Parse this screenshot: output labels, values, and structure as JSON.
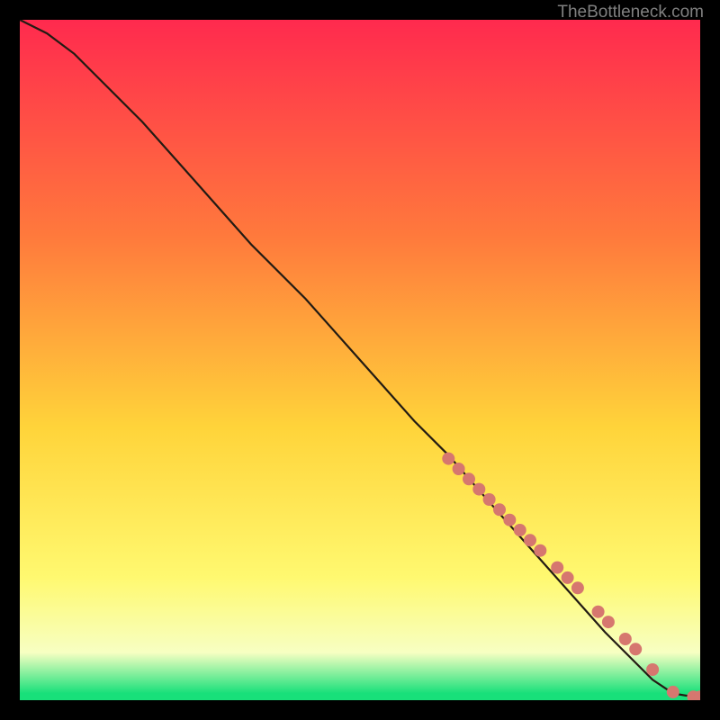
{
  "attribution": "TheBottleneck.com",
  "accent_colors": {
    "top": "#ff2a4e",
    "mid1": "#ff7a3c",
    "mid2": "#ffd43a",
    "mid3": "#fff970",
    "mid4": "#f7ffc2",
    "bottom": "#18e07a",
    "curve": "#221b13",
    "marker": "#d6776f"
  },
  "chart_data": {
    "type": "line",
    "title": "",
    "xlabel": "",
    "ylabel": "",
    "xlim": [
      0,
      100
    ],
    "ylim": [
      0,
      100
    ],
    "curve": {
      "x": [
        0,
        4,
        8,
        12,
        18,
        26,
        34,
        42,
        50,
        58,
        63,
        70,
        78,
        86,
        93,
        96,
        99,
        100
      ],
      "y": [
        100,
        98,
        95,
        91,
        85,
        76,
        67,
        59,
        50,
        41,
        36,
        28,
        19,
        10,
        3,
        1,
        0.5,
        0.5
      ]
    },
    "markers": {
      "x": [
        63,
        64.5,
        66,
        67.5,
        69,
        70.5,
        72,
        73.5,
        75,
        76.5,
        79,
        80.5,
        82,
        85,
        86.5,
        89,
        90.5,
        93,
        96,
        99,
        100
      ],
      "y": [
        35.5,
        34,
        32.5,
        31,
        29.5,
        28,
        26.5,
        25,
        23.5,
        22,
        19.5,
        18,
        16.5,
        13,
        11.5,
        9,
        7.5,
        4.5,
        1.2,
        0.5,
        0.5
      ]
    }
  }
}
